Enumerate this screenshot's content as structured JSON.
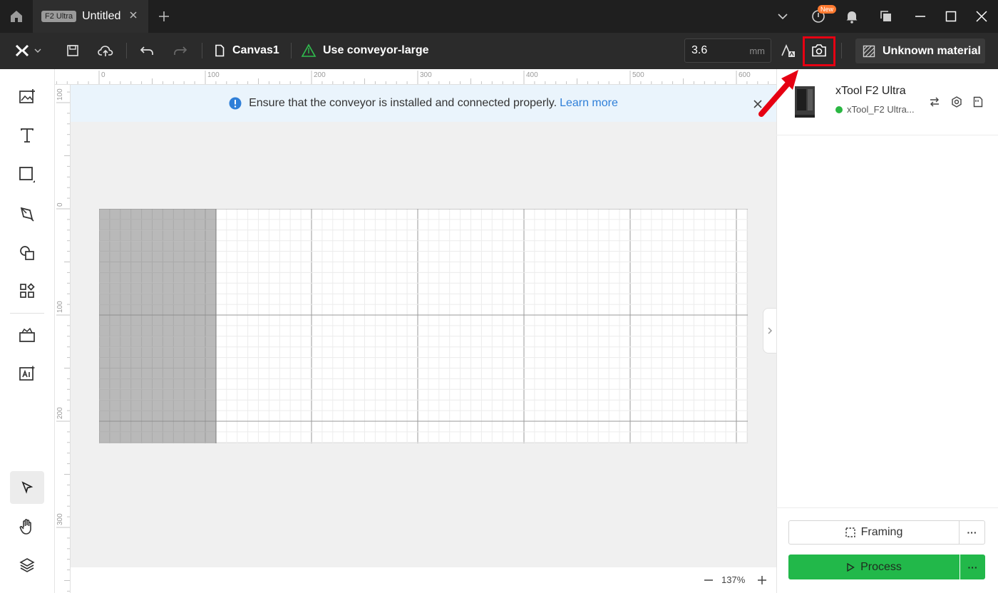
{
  "titlebar": {
    "tab": {
      "badge": "F2 Ultra",
      "title": "Untitled"
    },
    "new_badge": "New"
  },
  "toolbar": {
    "canvas_label": "Canvas1",
    "conveyor_label": "Use conveyor-large",
    "thickness_value": "3.6",
    "thickness_unit": "mm",
    "material_label": "Unknown material"
  },
  "notice": {
    "text": "Ensure that the conveyor is installed and connected properly.",
    "link": "Learn more"
  },
  "rulers": {
    "top_ticks": [
      "0",
      "100",
      "200",
      "300",
      "400",
      "500",
      "600"
    ],
    "left_ticks": [
      "100",
      "0",
      "100",
      "200",
      "300"
    ]
  },
  "device": {
    "name": "xTool F2 Ultra",
    "connection": "xTool_F2 Ultra...",
    "status_color": "#2ab742"
  },
  "actions": {
    "framing_label": "Framing",
    "process_label": "Process",
    "more_label": "···"
  },
  "status": {
    "zoom_label": "137%"
  },
  "colors": {
    "accent_green": "#22b84a",
    "highlight_red": "#e60012",
    "link_blue": "#2f7fd8"
  }
}
